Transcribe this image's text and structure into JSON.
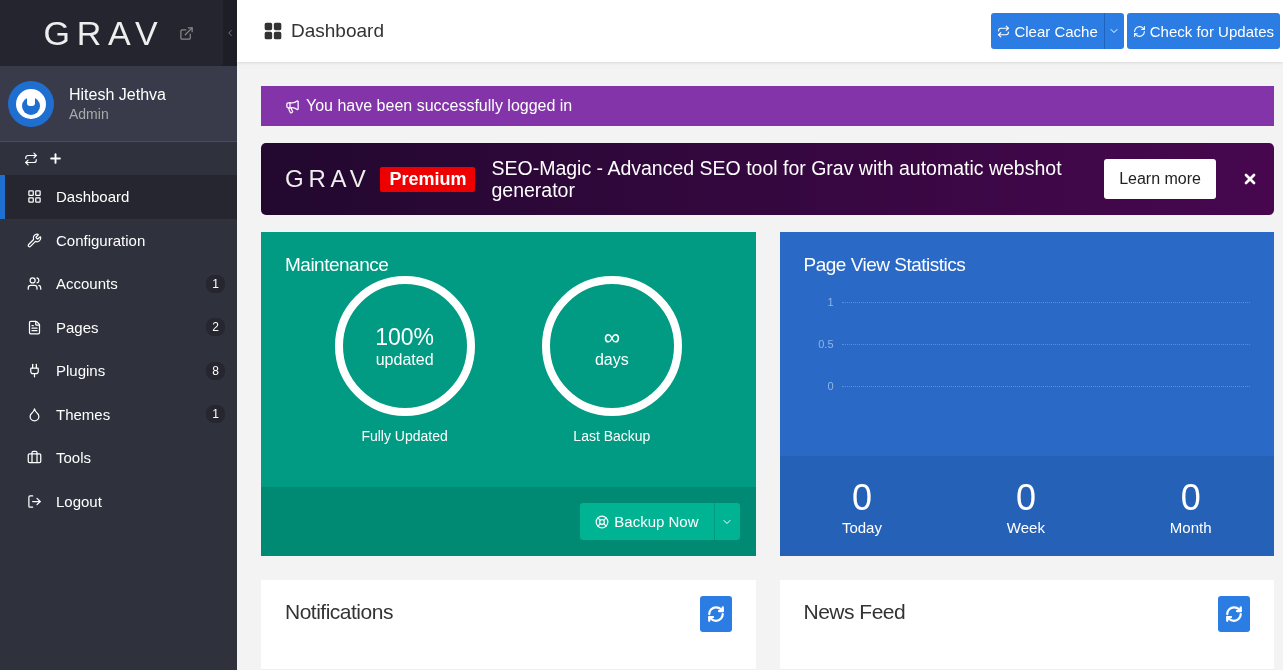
{
  "sidebar": {
    "logo": "GRAV",
    "user": {
      "name": "Hitesh Jethva",
      "role": "Admin"
    },
    "items": [
      {
        "label": "Dashboard",
        "selected": true
      },
      {
        "label": "Configuration",
        "selected": false
      },
      {
        "label": "Accounts",
        "badge": "1",
        "selected": false
      },
      {
        "label": "Pages",
        "badge": "2",
        "selected": false
      },
      {
        "label": "Plugins",
        "badge": "8",
        "selected": false
      },
      {
        "label": "Themes",
        "badge": "1",
        "selected": false
      },
      {
        "label": "Tools",
        "selected": false
      },
      {
        "label": "Logout",
        "selected": false
      }
    ]
  },
  "header": {
    "title": "Dashboard",
    "buttons": [
      "Clear Cache",
      "Check for Updates"
    ]
  },
  "alert": "You have been successfully logged in",
  "promo": {
    "logo": "GRAV",
    "badge": "Premium",
    "text": "SEO-Magic - Advanced SEO tool for Grav with automatic webshot generator",
    "button": "Learn more"
  },
  "maintenance": {
    "title": "Maintenance",
    "gauges": [
      {
        "value": "100%",
        "unit": "updated",
        "caption": "Fully Updated"
      },
      {
        "value": "∞",
        "unit": "days",
        "caption": "Last Backup"
      }
    ],
    "button": "Backup Now"
  },
  "stats": {
    "title": "Page View Statistics",
    "axis_labels": [
      "1",
      "0.5",
      "0"
    ],
    "totals": [
      {
        "value": "0",
        "label": "Today"
      },
      {
        "value": "0",
        "label": "Week"
      },
      {
        "value": "0",
        "label": "Month"
      }
    ]
  },
  "panels": [
    {
      "title": "Notifications"
    },
    {
      "title": "News Feed"
    }
  ]
}
